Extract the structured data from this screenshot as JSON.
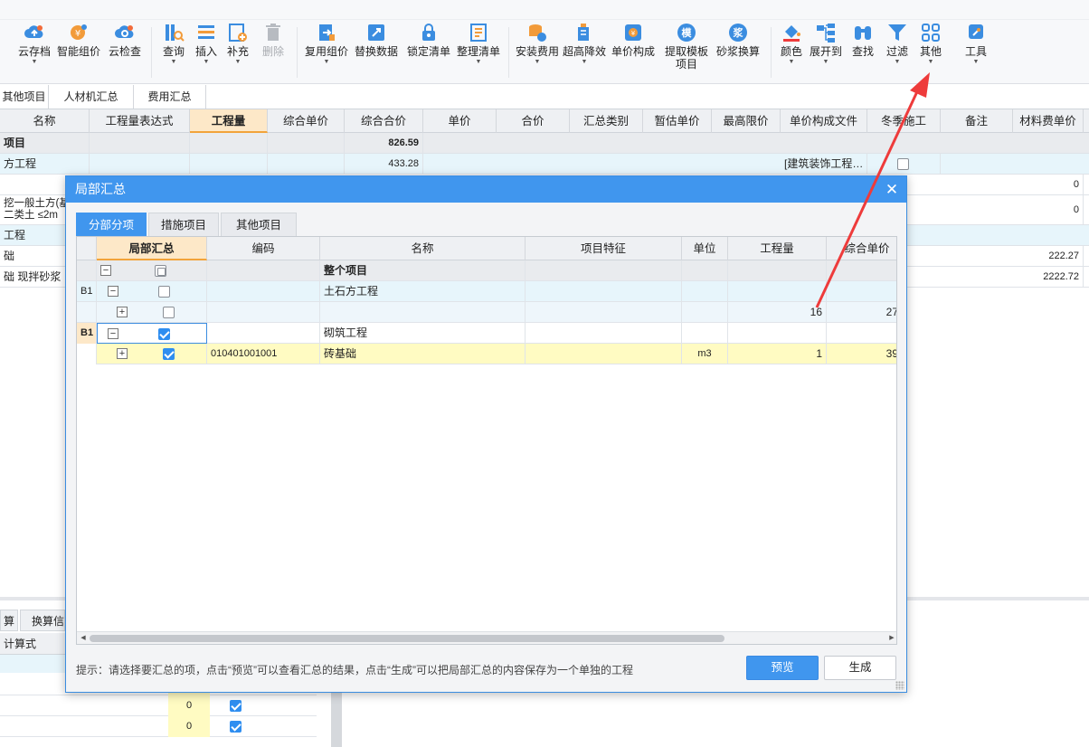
{
  "ribbon": {
    "buttons": [
      {
        "label": "云存档",
        "icon": "cloud-upload-icon",
        "caret": true
      },
      {
        "label": "智能组价",
        "icon": "smart-pricing-icon",
        "caret": false
      },
      {
        "label": "云检查",
        "icon": "cloud-check-icon",
        "caret": false
      },
      {
        "label": "查询",
        "icon": "query-icon",
        "caret": true
      },
      {
        "label": "插入",
        "icon": "insert-icon",
        "caret": true
      },
      {
        "label": "补充",
        "icon": "supplement-icon",
        "caret": true
      },
      {
        "label": "删除",
        "icon": "trash-icon",
        "caret": false
      },
      {
        "label": "复用组价",
        "icon": "reuse-pricing-icon",
        "caret": true
      },
      {
        "label": "替换数据",
        "icon": "replace-data-icon",
        "caret": false
      },
      {
        "label": "锁定清单",
        "icon": "lock-icon",
        "caret": false
      },
      {
        "label": "整理清单",
        "icon": "organize-list-icon",
        "caret": true
      },
      {
        "label": "安装费用",
        "icon": "install-cost-icon",
        "caret": true
      },
      {
        "label": "超高降效",
        "icon": "height-efficiency-icon",
        "caret": true
      },
      {
        "label": "单价构成",
        "icon": "unit-price-icon",
        "caret": false
      },
      {
        "label": "提取模板",
        "label2": "项目",
        "icon": "template-icon",
        "glyph": "模",
        "caret": false
      },
      {
        "label": "砂浆换算",
        "icon": "mortar-icon",
        "glyph": "浆",
        "caret": false
      },
      {
        "label": "颜色",
        "icon": "paint-bucket-icon",
        "caret": true
      },
      {
        "label": "展开到",
        "icon": "expand-tree-icon",
        "caret": true
      },
      {
        "label": "查找",
        "icon": "binoculars-icon",
        "caret": false
      },
      {
        "label": "过滤",
        "icon": "filter-icon",
        "caret": true
      },
      {
        "label": "其他",
        "icon": "grid-apps-icon",
        "caret": true
      },
      {
        "label": "工具",
        "icon": "tools-icon",
        "caret": true
      }
    ]
  },
  "subtabs": [
    "其他项目",
    "人材机汇总",
    "费用汇总"
  ],
  "grid": {
    "columns": [
      "名称",
      "工程量表达式",
      "工程量",
      "综合单价",
      "综合合价",
      "单价",
      "合价",
      "汇总类别",
      "暂估单价",
      "最高限价",
      "单价构成文件",
      "冬季施工",
      "备注",
      "材料费单价"
    ],
    "rows": [
      {
        "name": "项目",
        "total": "826.59",
        "tpl": "",
        "mat": ""
      },
      {
        "name": "方工程",
        "total": "433.28",
        "tpl": "[建筑装饰工程…",
        "mat": ""
      },
      {
        "name": "",
        "total": "",
        "tpl": "",
        "mat": "0"
      },
      {
        "name": "挖一般土方(基",
        "name2": "二类土 ≤2m",
        "total": "",
        "tpl": "",
        "mat": "0"
      },
      {
        "name": "工程",
        "total": "",
        "tpl": "",
        "mat": ""
      },
      {
        "name": "础",
        "total": "",
        "tpl": "",
        "mat": "222.27"
      },
      {
        "name": "础 现拌砂浆",
        "total": "",
        "tpl": "",
        "mat": "2222.72"
      }
    ]
  },
  "lower": {
    "tabs": [
      "算",
      "换算信"
    ],
    "header": "计算式",
    "values": [
      "0",
      "0",
      "0"
    ]
  },
  "dialog": {
    "title": "局部汇总",
    "tabs": [
      "分部分项",
      "措施项目",
      "其他项目"
    ],
    "columns": [
      "局部汇总",
      "编码",
      "名称",
      "项目特征",
      "单位",
      "工程量",
      "综合单价"
    ],
    "rows": [
      {
        "marker": "",
        "code": "",
        "name": "整个项目",
        "unit": "",
        "qty": "",
        "price": "",
        "checked": "partial"
      },
      {
        "marker": "B1",
        "code": "",
        "name": "土石方工程",
        "unit": "",
        "qty": "",
        "price": "",
        "checked": "off"
      },
      {
        "marker": "",
        "code": "",
        "name": "",
        "unit": "",
        "qty": "16",
        "price": "27",
        "checked": "off"
      },
      {
        "marker": "B1",
        "code": "",
        "name": "砌筑工程",
        "unit": "",
        "qty": "",
        "price": "",
        "checked": "on"
      },
      {
        "marker": "",
        "code": "010401001001",
        "name": "砖基础",
        "unit": "m3",
        "qty": "1",
        "price": "39",
        "checked": "on"
      }
    ],
    "hint": "提示：请选择要汇总的项，点击“预览”可以查看汇总的结果，点击“生成”可以把局部汇总的内容保存为一个单独的工程",
    "preview_label": "预览",
    "generate_label": "生成"
  },
  "colors": {
    "accent": "#4096ee",
    "arrow": "#ee3b3b",
    "highlight": "#fffbc2"
  }
}
